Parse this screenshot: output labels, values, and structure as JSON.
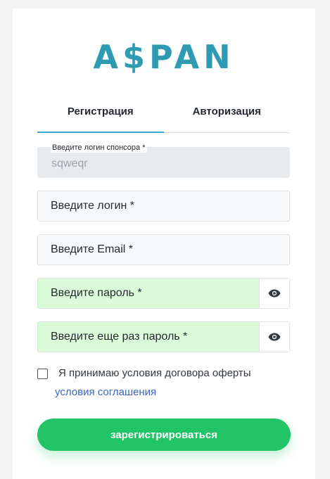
{
  "brand": {
    "logo_text": "A$PAN",
    "color": "#2f9bb3"
  },
  "tabs": [
    {
      "label": "Регистрация",
      "active": true
    },
    {
      "label": "Авторизация",
      "active": false
    }
  ],
  "form": {
    "sponsor": {
      "label": "Введите логин спонсора *",
      "value": "sqweqr"
    },
    "login": {
      "placeholder": "Введите логин *"
    },
    "email": {
      "placeholder": "Введите Email *"
    },
    "password": {
      "placeholder": "Введите пароль *",
      "icon": "eye-icon"
    },
    "password_repeat": {
      "placeholder": "Введите еще раз пароль *",
      "icon": "eye-icon"
    },
    "agree": {
      "text": "Я принимаю условия договора оферты",
      "link": "условия соглашения",
      "checked": false
    },
    "submit_label": "зарегистрироваться"
  },
  "colors": {
    "accent": "#3ea6cf",
    "submit": "#21c466",
    "password_bg": "#dbfcd9",
    "link": "#3d67c3"
  }
}
